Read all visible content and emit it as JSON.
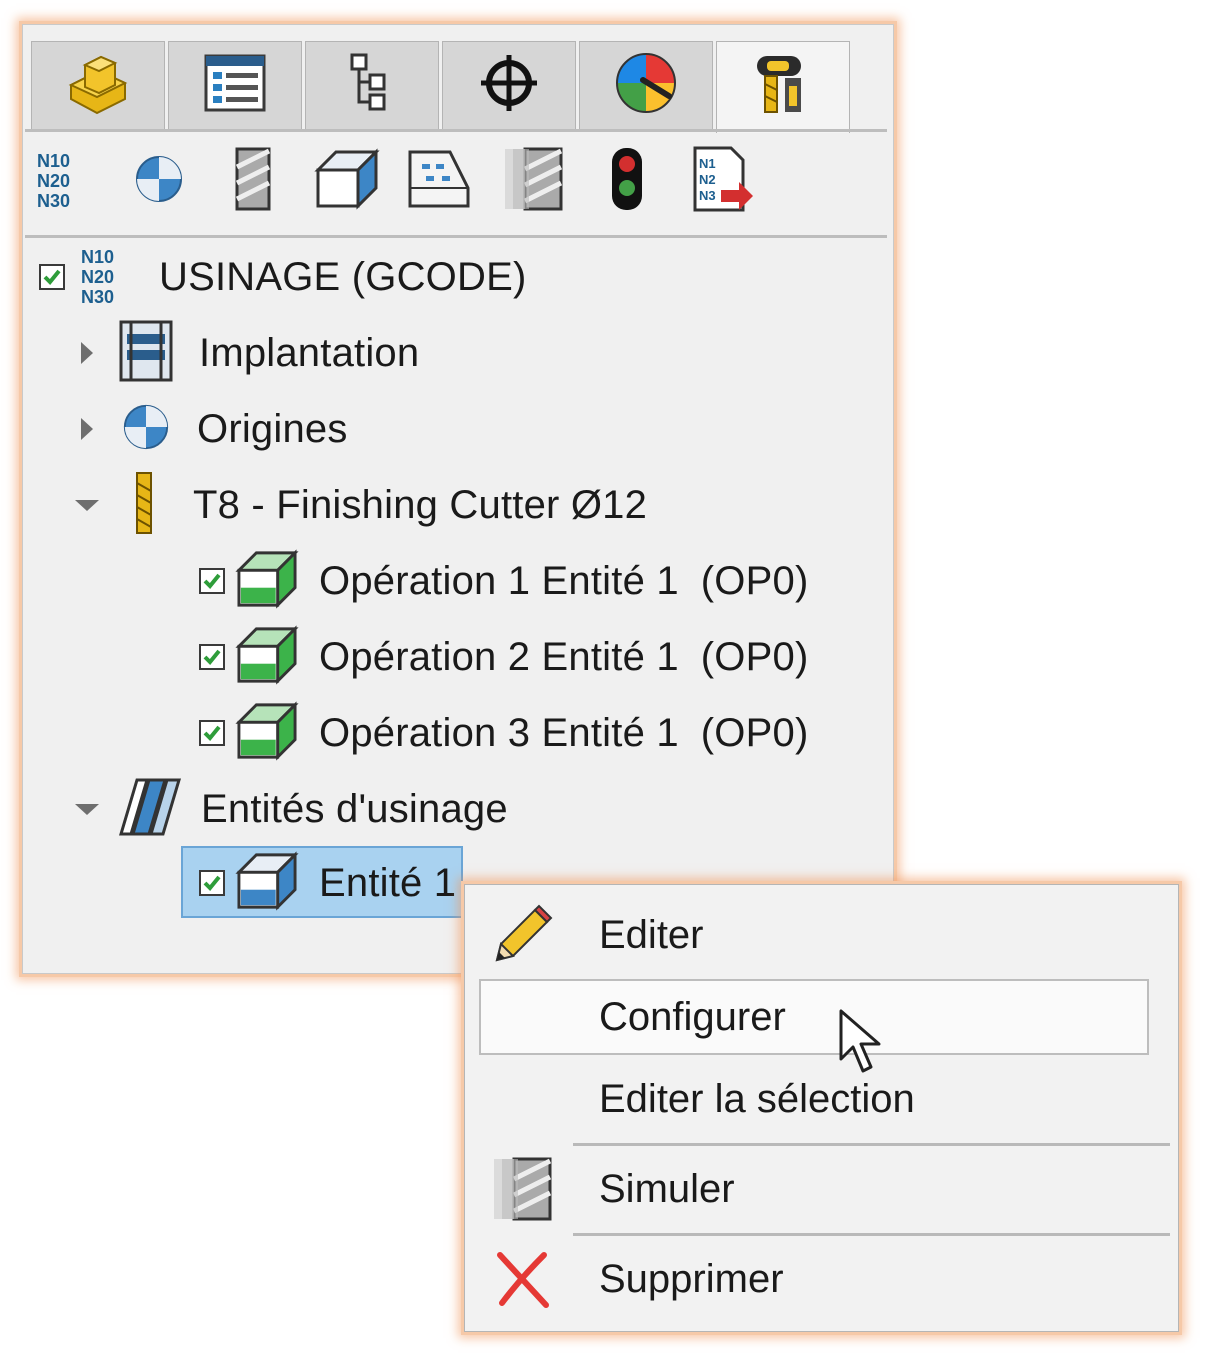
{
  "tabs": [
    {
      "icon": "part-icon"
    },
    {
      "icon": "property-list-icon"
    },
    {
      "icon": "config-tree-icon"
    },
    {
      "icon": "crosshair-icon"
    },
    {
      "icon": "appearance-pie-icon"
    },
    {
      "icon": "cam-addin-icon"
    }
  ],
  "toolbar": [
    {
      "icon": "gcode-icon"
    },
    {
      "icon": "origin-icon"
    },
    {
      "icon": "tool-icon"
    },
    {
      "icon": "feature-box-icon"
    },
    {
      "icon": "pocket-feature-icon"
    },
    {
      "icon": "simulate-icon"
    },
    {
      "icon": "traffic-light-icon"
    },
    {
      "icon": "export-gcode-icon"
    }
  ],
  "tree": {
    "root": {
      "label": "USINAGE (GCODE)",
      "checked": true
    },
    "implantation": {
      "label": "Implantation"
    },
    "origines": {
      "label": "Origines"
    },
    "tool": {
      "label": "T8 - Finishing Cutter Ø12"
    },
    "operations": [
      {
        "label": "Opération 1 Entité 1",
        "code": "(OP0)",
        "checked": true
      },
      {
        "label": "Opération 2 Entité 1",
        "code": "(OP0)",
        "checked": true
      },
      {
        "label": "Opération 3 Entité 1",
        "code": "(OP0)",
        "checked": true
      }
    ],
    "features": {
      "label": "Entités d'usinage"
    },
    "feature1": {
      "label": "Entité 1",
      "checked": true
    }
  },
  "context_menu": {
    "edit": "Editer",
    "configure": "Configurer",
    "edit_selection": "Editer la sélection",
    "simulate": "Simuler",
    "delete": "Supprimer"
  },
  "colors": {
    "accent_orange": "#f3a16a",
    "selection": "#a9d2f0",
    "green": "#3cb34a"
  }
}
